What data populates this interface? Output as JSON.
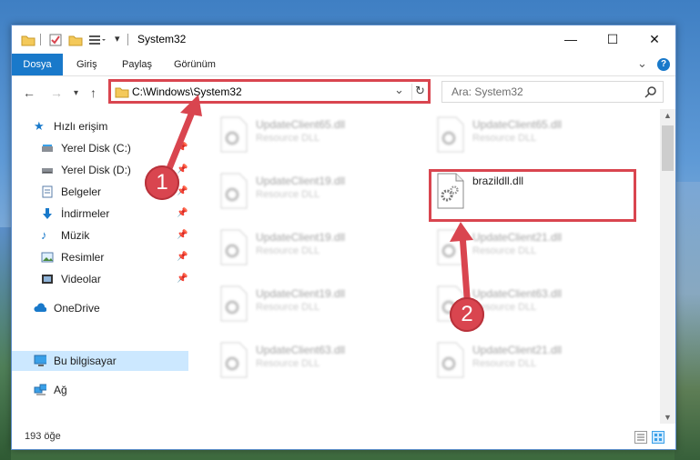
{
  "window": {
    "title": "System32",
    "controls": {
      "minimize": "—",
      "maximize": "☐",
      "close": "✕"
    }
  },
  "ribbon": {
    "tabs": [
      "Dosya",
      "Giriş",
      "Paylaş",
      "Görünüm"
    ],
    "expand": "⌄",
    "help": "?"
  },
  "address": {
    "path": "C:\\Windows\\System32",
    "refresh": "↻",
    "dropdown": "⌄"
  },
  "search": {
    "placeholder": "Ara: System32"
  },
  "sidebar": {
    "items": [
      {
        "label": "Hızlı erişim",
        "icon": "star-icon"
      },
      {
        "label": "Yerel Disk (C:)",
        "icon": "drive-icon",
        "pinned": true
      },
      {
        "label": "Yerel Disk (D:)",
        "icon": "drive-icon",
        "pinned": true
      },
      {
        "label": "Belgeler",
        "icon": "document-icon",
        "pinned": true
      },
      {
        "label": "İndirmeler",
        "icon": "download-icon",
        "pinned": true
      },
      {
        "label": "Müzik",
        "icon": "music-icon",
        "pinned": true
      },
      {
        "label": "Resimler",
        "icon": "pictures-icon",
        "pinned": true
      },
      {
        "label": "Videolar",
        "icon": "video-icon",
        "pinned": true
      },
      {
        "label": "OneDrive",
        "icon": "cloud-icon"
      },
      {
        "label": "Bu bilgisayar",
        "icon": "computer-icon",
        "selected": true
      },
      {
        "label": "Ağ",
        "icon": "network-icon"
      }
    ]
  },
  "files": [
    {
      "name": "UpdateClient65.dll",
      "type": "Resource DLL"
    },
    {
      "name": "UpdateClient65.dll",
      "type": "Resource DLL"
    },
    {
      "name": "UpdateClient19.dll",
      "type": "Resource DLL"
    },
    {
      "name": "brazildll.dll",
      "type": ""
    },
    {
      "name": "UpdateClient19.dll",
      "type": "Resource DLL"
    },
    {
      "name": "UpdateClient21.dll",
      "type": "Resource DLL"
    },
    {
      "name": "UpdateClient19.dll",
      "type": "Resource DLL"
    },
    {
      "name": "UpdateClient63.dll",
      "type": "Resource DLL"
    },
    {
      "name": "UpdateClient63.dll",
      "type": "Resource DLL"
    },
    {
      "name": "UpdateClient21.dll",
      "type": "Resource DLL"
    }
  ],
  "status": {
    "count": "193 öğe"
  },
  "markers": {
    "one": "1",
    "two": "2"
  }
}
